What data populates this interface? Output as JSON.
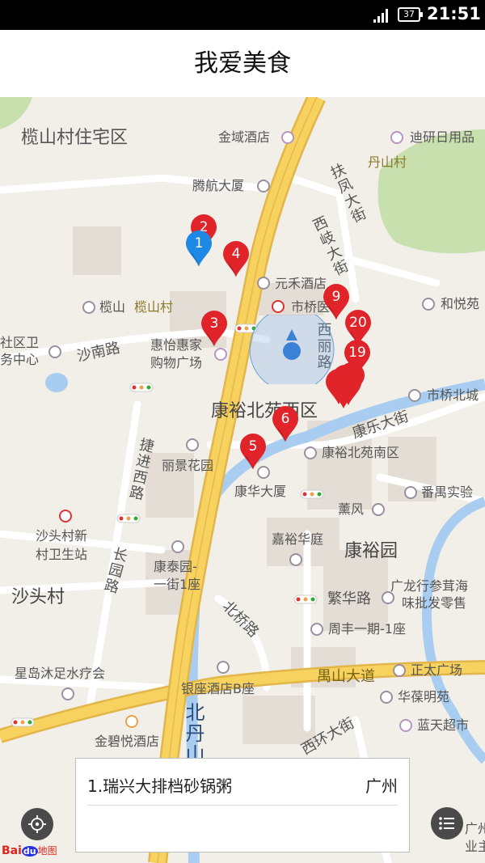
{
  "status_bar": {
    "battery": "37",
    "time": "21:51"
  },
  "title": "我爱美食",
  "map": {
    "place_labels": {
      "lanshancun_residential": "榄山村住宅区",
      "jinyu_hotel": "金域酒店",
      "diyan_goods": "迪研日用品",
      "danshancun": "丹山村",
      "tenghang_building": "腾航大厦",
      "yuanhe_hotel": "元禾酒店",
      "shiqiao_hospital": "市桥医",
      "heyue": "和悦苑",
      "lanshan_poi": "榄山",
      "lanshancun": "榄山村",
      "community_health_1": "社区卫",
      "community_health_2": "务中心",
      "huiyi_1": "惠怡惠家",
      "huiyi_2": "购物广场",
      "shiqiaobeicheng": "市桥北城",
      "kangyu_north_west": "康裕北苑西区",
      "kangyu_north_south": "康裕北苑南区",
      "lijing_garden": "丽景花园",
      "kanghua_building": "康华大厦",
      "panyu_school": "番禺实验",
      "xunfeng": "薰风",
      "jiayu_huating": "嘉裕华庭",
      "kangyu_yuan": "康裕园",
      "shatou_health_1": "沙头村新",
      "shatou_health_2": "村卫生站",
      "kangtai_1": "康泰园-",
      "kangtai_2": "一街1座",
      "guanglong_1": "广龙行参茸海",
      "guanglong_2": "味批发零售",
      "shatoucun": "沙头村",
      "zhoufeng": "周丰一期-1座",
      "xingdao_spa": "星岛沐足水疗会",
      "zhengtai_plaza": "正太广场",
      "yinzuo_hotel": "银座酒店B座",
      "huahao_mingyuan": "华葆明苑",
      "jinbiyue_hotel": "金碧悦酒店",
      "lantian_market": "蓝天超市",
      "guangzhou_partial": "广州",
      "yezhu_partial": "业主"
    },
    "road_labels": {
      "fufeng_street": "扶凤大街",
      "xiqi_street": "西岐大街",
      "xili_road": "西丽路",
      "shanan_road": "沙南路",
      "jiejin_west_road": "捷进西路",
      "kangle_street": "康乐大街",
      "changyuan_road": "长园路",
      "fanhua_road": "繁华路",
      "beiqiao_road": "北桥路",
      "zhoushan_avenue": "禺山大道",
      "xihuan_street": "西环大街",
      "beidan_partial": "北丹山"
    },
    "pins": [
      {
        "num": "1",
        "color": "#1e88e5"
      },
      {
        "num": "2",
        "color": "#e0242a"
      },
      {
        "num": "3",
        "color": "#e0242a"
      },
      {
        "num": "4",
        "color": "#e0242a"
      },
      {
        "num": "5",
        "color": "#e0242a"
      },
      {
        "num": "6",
        "color": "#e0242a"
      },
      {
        "num": "9",
        "color": "#e0242a"
      },
      {
        "num": "19",
        "color": "#e0242a"
      },
      {
        "num": "20",
        "color": "#e0242a"
      }
    ]
  },
  "result_card": {
    "name": "1.瑞兴大排档砂锅粥",
    "city": "广州"
  },
  "controls": {
    "locate_icon": "locate-icon",
    "list_icon": "list-icon"
  },
  "brand": {
    "logo_bai": "Bai",
    "logo_du": "du",
    "logo_map": "地图"
  }
}
